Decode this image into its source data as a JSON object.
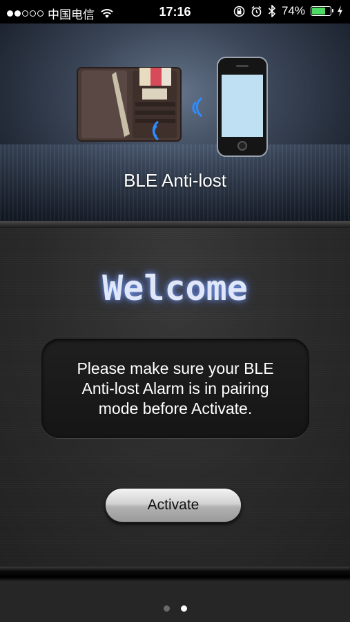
{
  "status_bar": {
    "signal_full": 2,
    "signal_empty": 3,
    "carrier": "中国电信",
    "time": "17:16",
    "battery": "74%",
    "battery_level": 0.74,
    "battery_color": "#4cd964"
  },
  "hero": {
    "title": "BLE Anti-lost"
  },
  "main": {
    "welcome": "Welcome",
    "message": "Please make sure your BLE Anti-lost Alarm is in pairing mode before Activate.",
    "activate_label": "Activate"
  },
  "pager": {
    "pages": 2,
    "current": 2
  },
  "colors": {
    "welcome_glow": "#7aa0ff",
    "signal_blue": "#2f8cff"
  }
}
